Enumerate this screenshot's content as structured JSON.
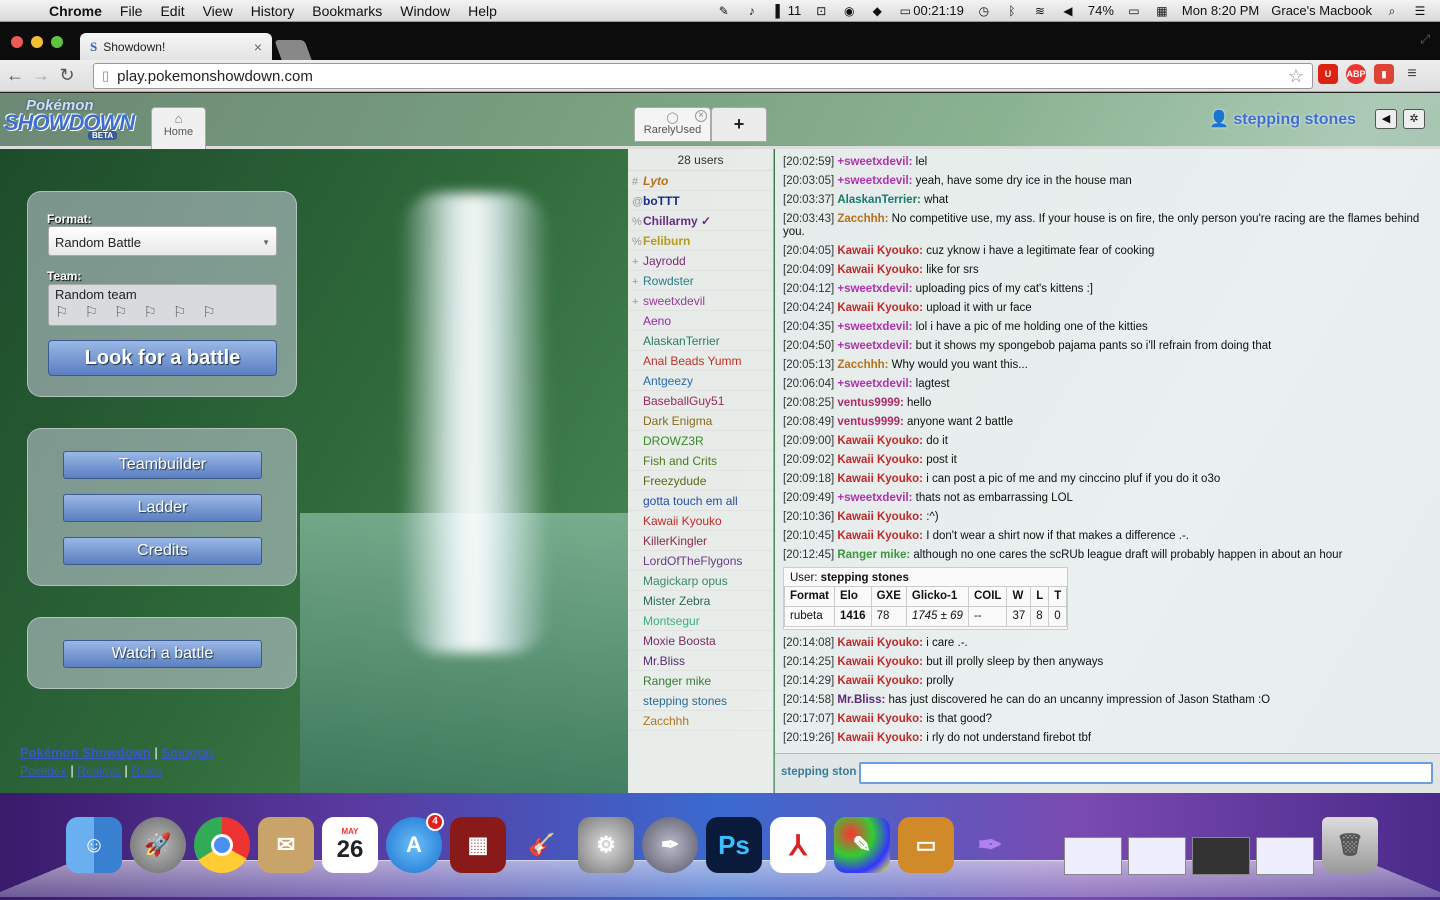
{
  "menubar": {
    "app": "Chrome",
    "items": [
      "File",
      "Edit",
      "View",
      "History",
      "Bookmarks",
      "Window",
      "Help"
    ],
    "status_count": "11",
    "timer": "00:21:19",
    "battery": "74%",
    "clock": "Mon 8:20 PM",
    "user": "Grace's Macbook"
  },
  "browser": {
    "tab_title": "Showdown!",
    "url": "play.pokemonshowdown.com",
    "extension_badge": "1"
  },
  "header": {
    "logo_top": "Pokémon",
    "logo_main": "SHOWDOWN",
    "logo_beta": "BETA",
    "home_label": "Home",
    "room_label": "RarelyUsed",
    "plus_label": "+",
    "username": "stepping stones"
  },
  "battle_panel": {
    "format_label": "Format:",
    "format_value": "Random Battle",
    "team_label": "Team:",
    "team_value": "Random team",
    "look_button": "Look for a battle"
  },
  "menu": {
    "teambuilder": "Teambuilder",
    "ladder": "Ladder",
    "credits": "Credits",
    "watch": "Watch a battle"
  },
  "footer": {
    "link1": "Pokémon Showdown",
    "link2": "Smogon",
    "link3": "Pokédex",
    "link4": "Replays",
    "link5": "Rules"
  },
  "userlist": {
    "count": "28 users",
    "users": [
      {
        "rank": "#",
        "name": "Lyto",
        "color": "#b8701a",
        "style": "italic",
        "weight": "bold"
      },
      {
        "rank": "@",
        "name": "boTTT",
        "color": "#1a2a8a",
        "style": "normal",
        "weight": "bold"
      },
      {
        "rank": "%",
        "name": "Chillarmy ✓",
        "color": "#6a2a8a",
        "style": "normal",
        "weight": "bold"
      },
      {
        "rank": "%",
        "name": "Feliburn",
        "color": "#b89a1a",
        "style": "normal",
        "weight": "bold"
      },
      {
        "rank": "+",
        "name": "Jayrodd",
        "color": "#7a2a7a",
        "style": "normal",
        "weight": "normal"
      },
      {
        "rank": "+",
        "name": "Rowdster",
        "color": "#2a7a8a",
        "style": "normal",
        "weight": "normal"
      },
      {
        "rank": "+",
        "name": "sweetxdevil",
        "color": "#9a3a9a",
        "style": "normal",
        "weight": "normal"
      },
      {
        "rank": "",
        "name": "Aeno",
        "color": "#8a2aaa",
        "style": "normal",
        "weight": "normal"
      },
      {
        "rank": "",
        "name": "AlaskanTerrier",
        "color": "#2a7a6a",
        "style": "normal",
        "weight": "normal"
      },
      {
        "rank": "",
        "name": "Anal Beads Yumm",
        "color": "#c0302a",
        "style": "normal",
        "weight": "normal"
      },
      {
        "rank": "",
        "name": "Antgeezy",
        "color": "#2a6ab0",
        "style": "normal",
        "weight": "normal"
      },
      {
        "rank": "",
        "name": "BaseballGuy51",
        "color": "#9a2a5a",
        "style": "normal",
        "weight": "normal"
      },
      {
        "rank": "",
        "name": "Dark Enigma",
        "color": "#8a6a1a",
        "style": "normal",
        "weight": "normal"
      },
      {
        "rank": "",
        "name": "DROWZ3R",
        "color": "#3a8a2a",
        "style": "normal",
        "weight": "normal"
      },
      {
        "rank": "",
        "name": "Fish and Crits",
        "color": "#4a7a1a",
        "style": "normal",
        "weight": "normal"
      },
      {
        "rank": "",
        "name": "Freezydude",
        "color": "#5a6a1a",
        "style": "normal",
        "weight": "normal"
      },
      {
        "rank": "",
        "name": "gotta touch em all",
        "color": "#2a4ab0",
        "style": "normal",
        "weight": "normal"
      },
      {
        "rank": "",
        "name": "Kawaii Kyouko",
        "color": "#c02a2a",
        "style": "normal",
        "weight": "normal"
      },
      {
        "rank": "",
        "name": "KillerKingler",
        "color": "#8a2a4a",
        "style": "normal",
        "weight": "normal"
      },
      {
        "rank": "",
        "name": "LordOfTheFlygons",
        "color": "#6a3a8a",
        "style": "normal",
        "weight": "normal"
      },
      {
        "rank": "",
        "name": "Magickarp opus",
        "color": "#3a8a6a",
        "style": "normal",
        "weight": "normal"
      },
      {
        "rank": "",
        "name": "Mister Zebra",
        "color": "#2a6a5a",
        "style": "normal",
        "weight": "normal"
      },
      {
        "rank": "",
        "name": "Montsegur",
        "color": "#3ab080",
        "style": "normal",
        "weight": "normal"
      },
      {
        "rank": "",
        "name": "Moxie Boosta",
        "color": "#7a2a6a",
        "style": "normal",
        "weight": "normal"
      },
      {
        "rank": "",
        "name": "Mr.Bliss",
        "color": "#5a2a7a",
        "style": "normal",
        "weight": "normal"
      },
      {
        "rank": "",
        "name": "Ranger mike",
        "color": "#3a7a3a",
        "style": "normal",
        "weight": "normal"
      },
      {
        "rank": "",
        "name": "stepping stones",
        "color": "#2a6a9a",
        "style": "normal",
        "weight": "normal"
      },
      {
        "rank": "",
        "name": "Zacchhh",
        "color": "#b8701a",
        "style": "normal",
        "weight": "normal"
      }
    ]
  },
  "chat": {
    "messages_before": [
      {
        "ts": "[20:02:59]",
        "name": "+sweetxdevil:",
        "color": "#b030b0",
        "text": " lel"
      },
      {
        "ts": "[20:03:05]",
        "name": "+sweetxdevil:",
        "color": "#b030b0",
        "text": " yeah, have some dry ice in the house man"
      },
      {
        "ts": "[20:03:37]",
        "name": "AlaskanTerrier:",
        "color": "#1a7a6a",
        "text": " what"
      },
      {
        "ts": "[20:03:43]",
        "name": "Zacchhh:",
        "color": "#b8701a",
        "text": " No competitive use, my ass. If your house is on fire, the only person you're racing are the flames behind you.",
        "wrap": true
      },
      {
        "ts": "[20:04:05]",
        "name": "Kawaii Kyouko:",
        "color": "#c02a2a",
        "text": " cuz yknow i have a legitimate fear of cooking"
      },
      {
        "ts": "[20:04:09]",
        "name": "Kawaii Kyouko:",
        "color": "#c02a2a",
        "text": " like for srs"
      },
      {
        "ts": "[20:04:12]",
        "name": "+sweetxdevil:",
        "color": "#b030b0",
        "text": " uploading pics of my cat's kittens :]"
      },
      {
        "ts": "[20:04:24]",
        "name": "Kawaii Kyouko:",
        "color": "#c02a2a",
        "text": " upload it with ur face"
      },
      {
        "ts": "[20:04:35]",
        "name": "+sweetxdevil:",
        "color": "#b030b0",
        "text": " lol i have a pic of me holding one of the kitties"
      },
      {
        "ts": "[20:04:50]",
        "name": "+sweetxdevil:",
        "color": "#b030b0",
        "text": " but it shows my spongebob pajama pants so i'll refrain from doing that"
      },
      {
        "ts": "[20:05:13]",
        "name": "Zacchhh:",
        "color": "#b8701a",
        "text": " Why would you want this..."
      },
      {
        "ts": "[20:06:04]",
        "name": "+sweetxdevil:",
        "color": "#b030b0",
        "text": " lagtest"
      },
      {
        "ts": "[20:08:25]",
        "name": "ventus9999:",
        "color": "#b02a6a",
        "text": " hello"
      },
      {
        "ts": "[20:08:49]",
        "name": "ventus9999:",
        "color": "#b02a6a",
        "text": " anyone want 2 battle"
      },
      {
        "ts": "[20:09:00]",
        "name": "Kawaii Kyouko:",
        "color": "#c02a2a",
        "text": " do it"
      },
      {
        "ts": "[20:09:02]",
        "name": "Kawaii Kyouko:",
        "color": "#c02a2a",
        "text": " post it"
      },
      {
        "ts": "[20:09:18]",
        "name": "Kawaii Kyouko:",
        "color": "#c02a2a",
        "text": " i can post a pic of me and my cinccino pluf if you do it o3o"
      },
      {
        "ts": "[20:09:49]",
        "name": "+sweetxdevil:",
        "color": "#b030b0",
        "text": " thats not as embarrassing LOL"
      },
      {
        "ts": "[20:10:36]",
        "name": "Kawaii Kyouko:",
        "color": "#c02a2a",
        "text": " :^)"
      },
      {
        "ts": "[20:10:45]",
        "name": "Kawaii Kyouko:",
        "color": "#c02a2a",
        "text": " I don't wear a shirt now if that makes a difference .-."
      },
      {
        "ts": "[20:12:45]",
        "name": "Ranger mike:",
        "color": "#3a9a3a",
        "text": " although no one cares the scRUb league draft will probably happen in about an hour"
      }
    ],
    "userinfo": {
      "label": "User: ",
      "name": "stepping stones",
      "headers": [
        "Format",
        "Elo",
        "GXE",
        "Glicko-1",
        "COIL",
        "W",
        "L",
        "T"
      ],
      "row": [
        "rubeta",
        "1416",
        "78",
        "1745 ± 69",
        "--",
        "37",
        "8",
        "0"
      ]
    },
    "messages_after": [
      {
        "ts": "[20:14:08]",
        "name": "Kawaii Kyouko:",
        "color": "#c02a2a",
        "text": " i care .-."
      },
      {
        "ts": "[20:14:25]",
        "name": "Kawaii Kyouko:",
        "color": "#c02a2a",
        "text": " but ill prolly sleep by then anyways"
      },
      {
        "ts": "[20:14:29]",
        "name": "Kawaii Kyouko:",
        "color": "#c02a2a",
        "text": " prolly"
      },
      {
        "ts": "[20:14:58]",
        "name": "Mr.Bliss:",
        "color": "#5a2a7a",
        "text": " has just discovered he can do an uncanny impression of Jason Statham :O"
      },
      {
        "ts": "[20:17:07]",
        "name": "Kawaii Kyouko:",
        "color": "#c02a2a",
        "text": " is that good?"
      },
      {
        "ts": "[20:19:26]",
        "name": "Kawaii Kyouko:",
        "color": "#c02a2a",
        "text": " i rly do not understand firebot tbf"
      }
    ],
    "input_name": "stepping stones"
  },
  "dock": {
    "calendar_month": "MAY",
    "calendar_day": "26",
    "appstore_badge": "4",
    "ps_label": "Ps"
  }
}
